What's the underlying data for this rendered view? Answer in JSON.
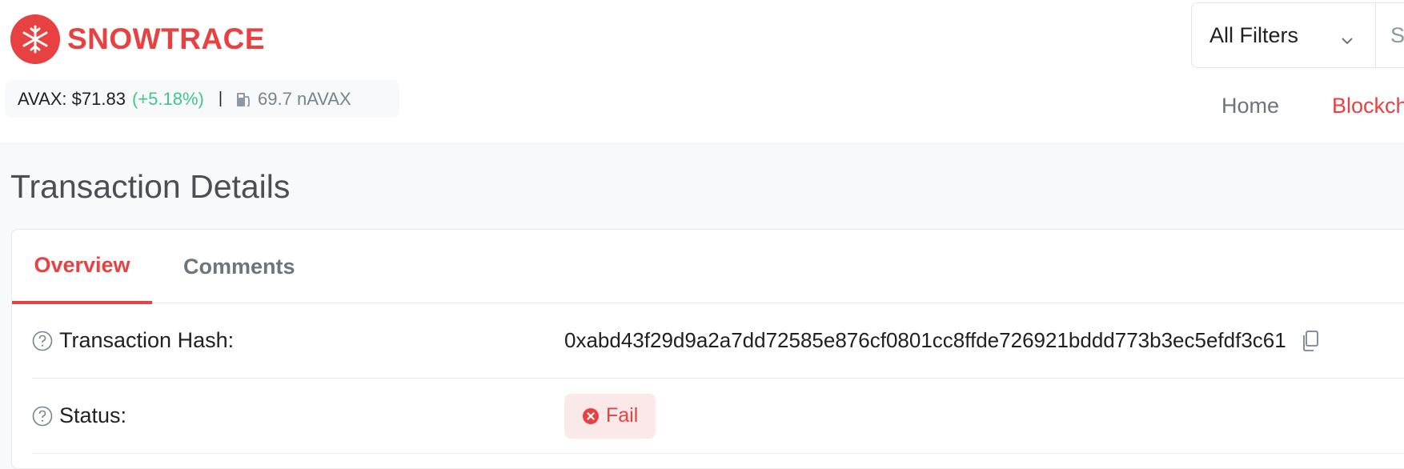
{
  "brand": {
    "name": "SNOWTRACE",
    "icon": "snowflake-icon",
    "color": "#e84142"
  },
  "price_bar": {
    "price_label": "AVAX: $71.83",
    "price_change": "(+5.18%)",
    "separator": "|",
    "gas_icon": "gas-pump-icon",
    "gas_value": "69.7 nAVAX"
  },
  "search": {
    "filter_label": "All Filters",
    "filter_icon": "chevron-down-icon",
    "placeholder_fragment": "S"
  },
  "nav": {
    "home": "Home",
    "blockchain": "Blockch"
  },
  "page": {
    "title": "Transaction Details"
  },
  "tabs": [
    {
      "label": "Overview",
      "active": true
    },
    {
      "label": "Comments",
      "active": false
    }
  ],
  "details": {
    "hash_label": "Transaction Hash:",
    "hash_value": "0xabd43f29d9a2a7dd72585e876cf0801cc8ffde726921bddd773b3ec5efdf3c61",
    "status_label": "Status:",
    "status_value": "Fail"
  },
  "colors": {
    "accent": "#e84142",
    "positive": "#3ec88a",
    "muted": "#77838f"
  }
}
